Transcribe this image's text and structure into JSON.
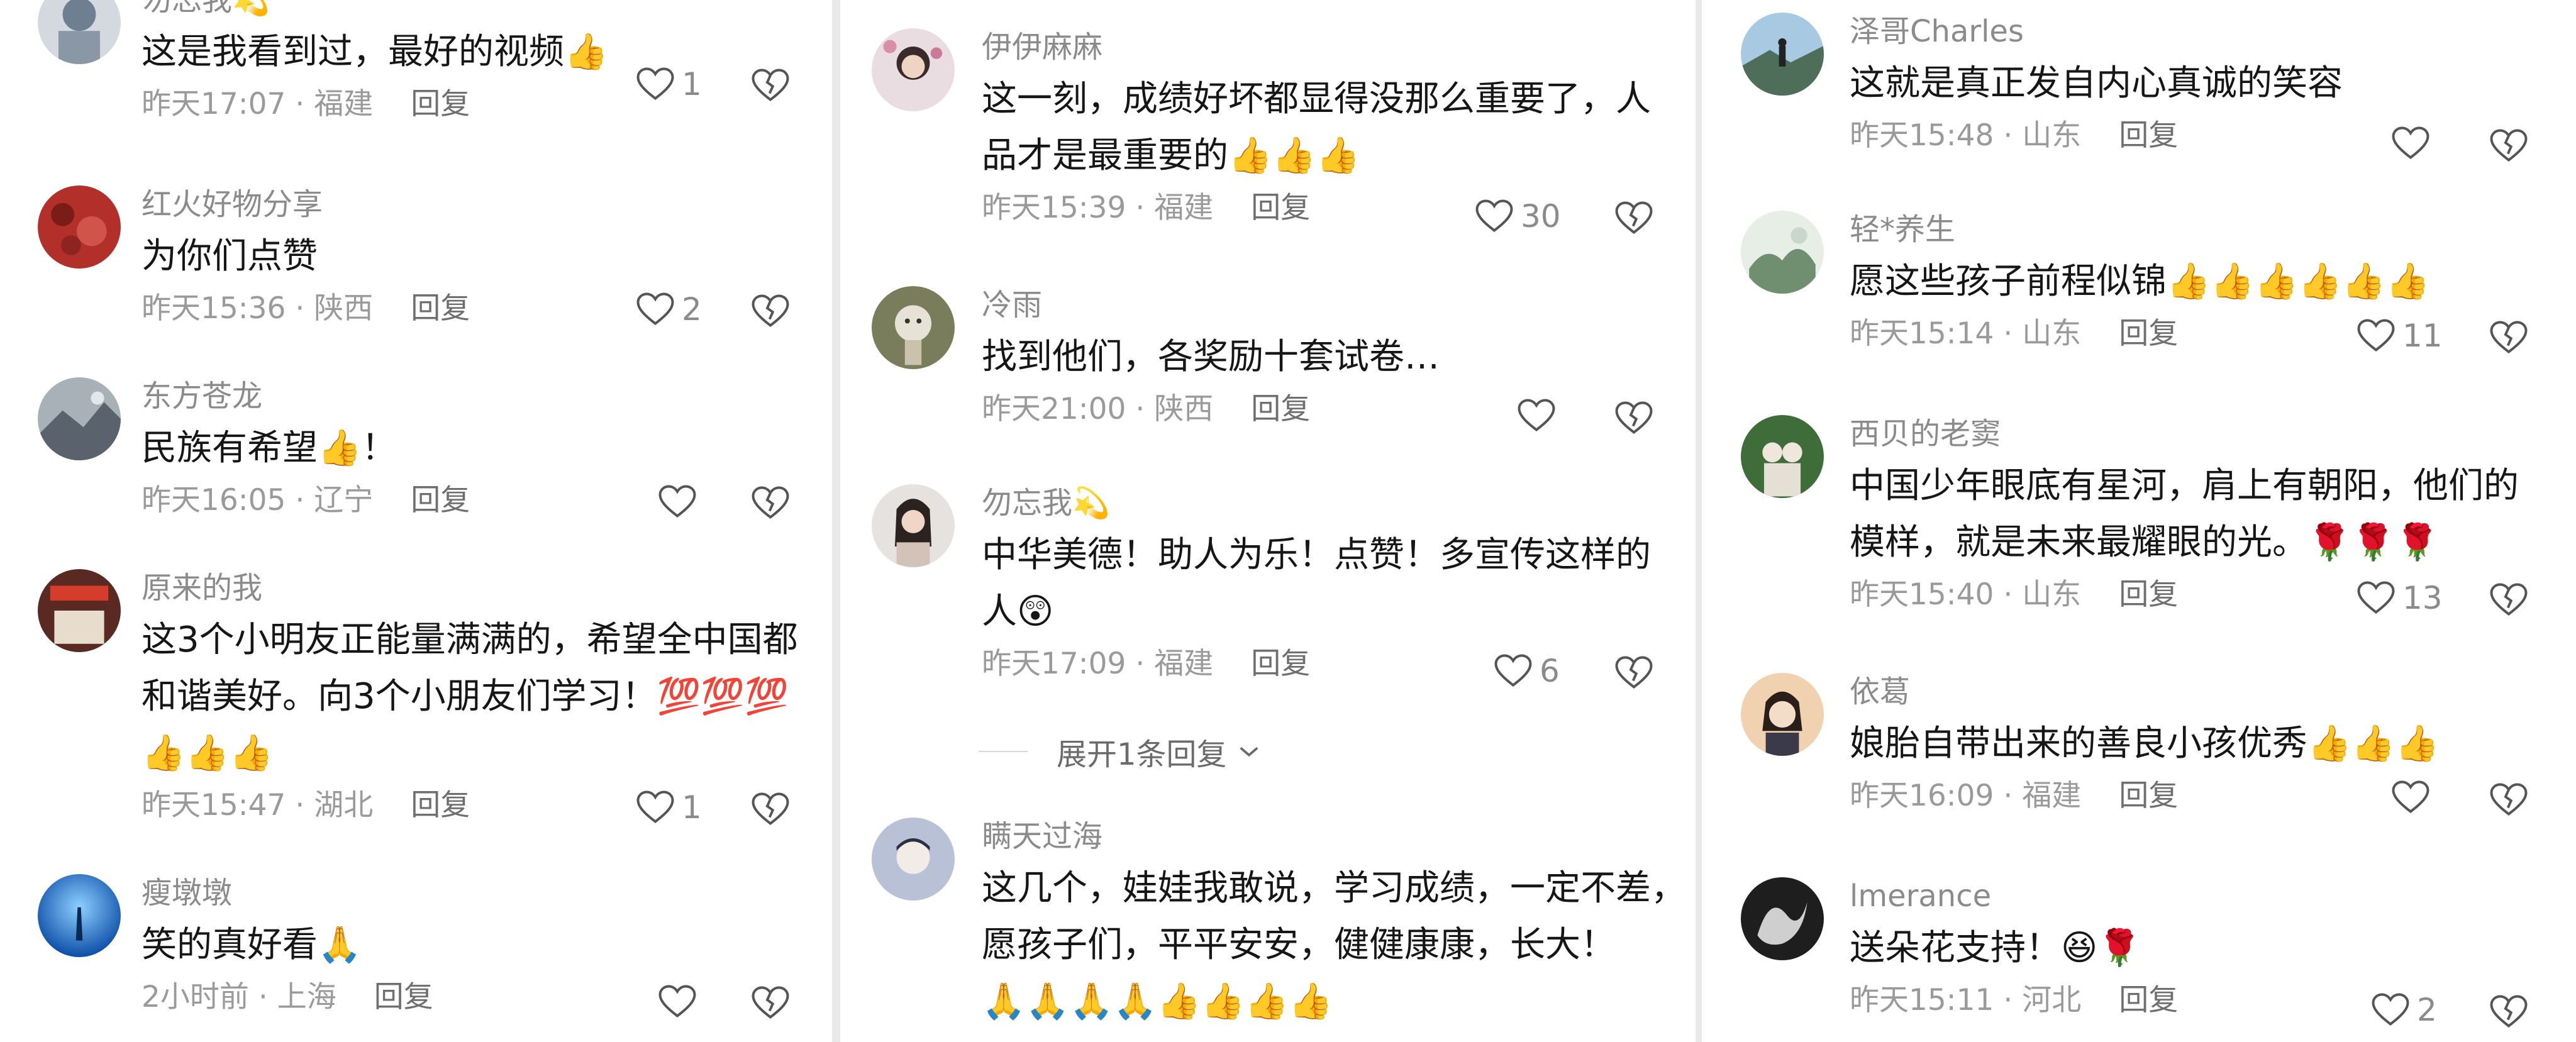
{
  "columns": [
    {
      "comments": [
        {
          "user": "勿忘我💫",
          "text": [
            "这是我看到过，最好的视频👍"
          ],
          "time": "昨天17:07",
          "region": "福建",
          "reply": "回复",
          "likes": "1",
          "avatar": "#6d7f91"
        },
        {
          "user": "红火好物分享",
          "text": [
            "为你们点赞"
          ],
          "time": "昨天15:36",
          "region": "陕西",
          "reply": "回复",
          "likes": "2",
          "avatar": "#b22f2a"
        },
        {
          "user": "东方苍龙",
          "text": [
            "民族有希望👍！"
          ],
          "time": "昨天16:05",
          "region": "辽宁",
          "reply": "回复",
          "likes": "",
          "avatar": "#7d8690"
        },
        {
          "user": "原来的我",
          "text": [
            "这3个小明友正能量满满的，希望全中国都",
            "和谐美好。向3个小朋友们学习！💯💯💯",
            "👍👍👍"
          ],
          "time": "昨天15:47",
          "region": "湖北",
          "reply": "回复",
          "likes": "1",
          "avatar": "#5a2a22"
        },
        {
          "user": "瘦墩墩",
          "text": [
            "笑的真好看🙏"
          ],
          "time": "2小时前",
          "region": "上海",
          "reply": "回复",
          "likes": "",
          "avatar": "#1f69c9"
        }
      ]
    },
    {
      "comments": [
        {
          "user": "伊伊麻麻",
          "text": [
            "这一刻，成绩好坏都显得没那么重要了，人",
            "品才是最重要的👍👍👍"
          ],
          "time": "昨天15:39",
          "region": "福建",
          "reply": "回复",
          "likes": "30",
          "avatar": "#c9a7b1"
        },
        {
          "user": "冷雨",
          "text": [
            "找到他们，各奖励十套试卷…"
          ],
          "time": "昨天21:00",
          "region": "陕西",
          "reply": "回复",
          "likes": "",
          "avatar": "#8a8a6b"
        },
        {
          "user": "勿忘我💫",
          "text": [
            "中华美德！助人为乐！点赞！多宣传这样的",
            "人😲"
          ],
          "time": "昨天17:09",
          "region": "福建",
          "reply": "回复",
          "likes": "6",
          "avatar": "#7c6b63"
        },
        {
          "user": "瞒天过海",
          "text": [
            "这几个，娃娃我敢说，学习成绩，一定不差，",
            "愿孩子们，平平安安，健健康康，长大！",
            "🙏🙏🙏🙏👍👍👍👍"
          ],
          "time": "",
          "region": "",
          "reply": "",
          "likes": "",
          "avatar": "#aab3c9"
        }
      ],
      "expand_label": "展开1条回复"
    },
    {
      "comments": [
        {
          "user": "泽哥Charles",
          "text": [
            "这就是真正发自内心真诚的笑容"
          ],
          "time": "昨天15:48",
          "region": "山东",
          "reply": "回复",
          "likes": "",
          "avatar": "#5d8fae"
        },
        {
          "user": "轻*养生",
          "text": [
            "愿这些孩子前程似锦👍👍👍👍👍👍"
          ],
          "time": "昨天15:14",
          "region": "山东",
          "reply": "回复",
          "likes": "11",
          "avatar": "#8aa58a"
        },
        {
          "user": "西贝的老窦",
          "text": [
            "中国少年眼底有星河，肩上有朝阳，他们的",
            "模样，就是未来最耀眼的光。🌹🌹🌹"
          ],
          "time": "昨天15:40",
          "region": "山东",
          "reply": "回复",
          "likes": "13",
          "avatar": "#3f6d3a"
        },
        {
          "user": "依葛",
          "text": [
            "娘胎自带出来的善良小孩优秀👍👍👍"
          ],
          "time": "昨天16:09",
          "region": "福建",
          "reply": "回复",
          "likes": "",
          "avatar": "#d8a070"
        },
        {
          "user": "lmerance",
          "text": [
            "送朵花支持！😆🌹"
          ],
          "time": "昨天15:11",
          "region": "河北",
          "reply": "回复",
          "likes": "2",
          "avatar": "#2a2a2a"
        }
      ]
    }
  ],
  "icons": {
    "like": "heart-outline-icon",
    "dislike": "broken-heart-icon",
    "expand": "chevron-down-icon"
  }
}
